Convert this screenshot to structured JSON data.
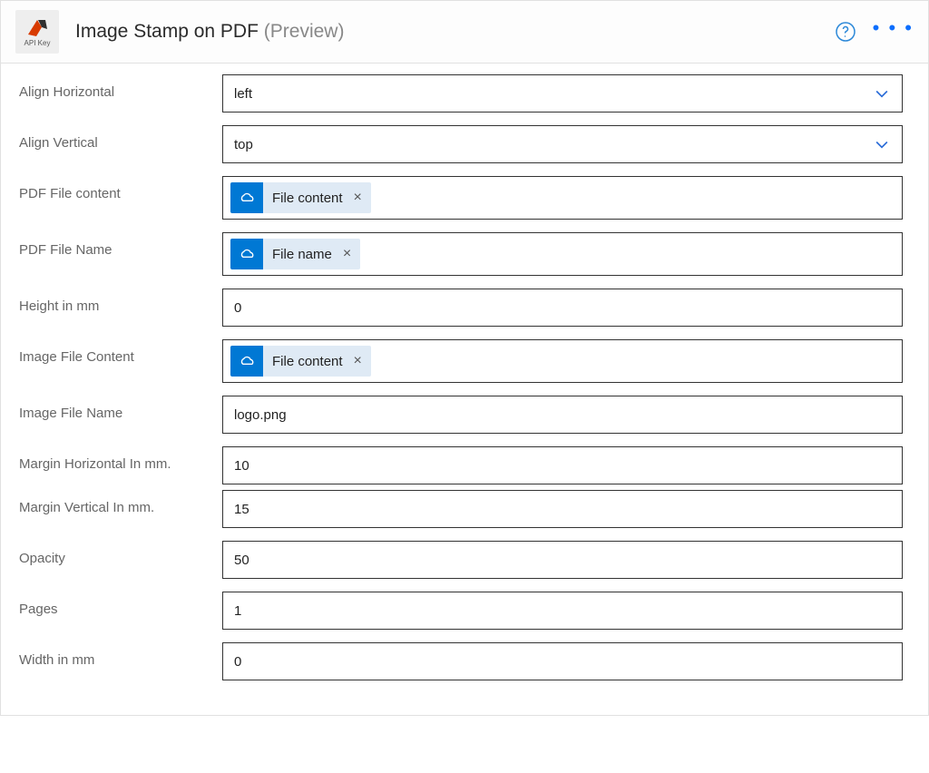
{
  "header": {
    "connector_icon_sublabel": "API Key",
    "title": "Image Stamp on PDF",
    "subtitle": "(Preview)"
  },
  "fields": {
    "align_horizontal": {
      "label": "Align Horizontal",
      "value": "left"
    },
    "align_vertical": {
      "label": "Align Vertical",
      "value": "top"
    },
    "pdf_file_content": {
      "label": "PDF File content",
      "token": "File content"
    },
    "pdf_file_name": {
      "label": "PDF File Name",
      "token": "File name"
    },
    "height_mm": {
      "label": "Height in mm",
      "value": "0"
    },
    "image_file_content": {
      "label": "Image File Content",
      "token": "File content"
    },
    "image_file_name": {
      "label": "Image File Name",
      "value": "logo.png"
    },
    "margin_h": {
      "label": "Margin Horizontal In mm.",
      "value": "10"
    },
    "margin_v": {
      "label": "Margin Vertical In mm.",
      "value": "15"
    },
    "opacity": {
      "label": "Opacity",
      "value": "50"
    },
    "pages": {
      "label": "Pages",
      "value": "1"
    },
    "width_mm": {
      "label": "Width in mm",
      "value": "0"
    }
  }
}
